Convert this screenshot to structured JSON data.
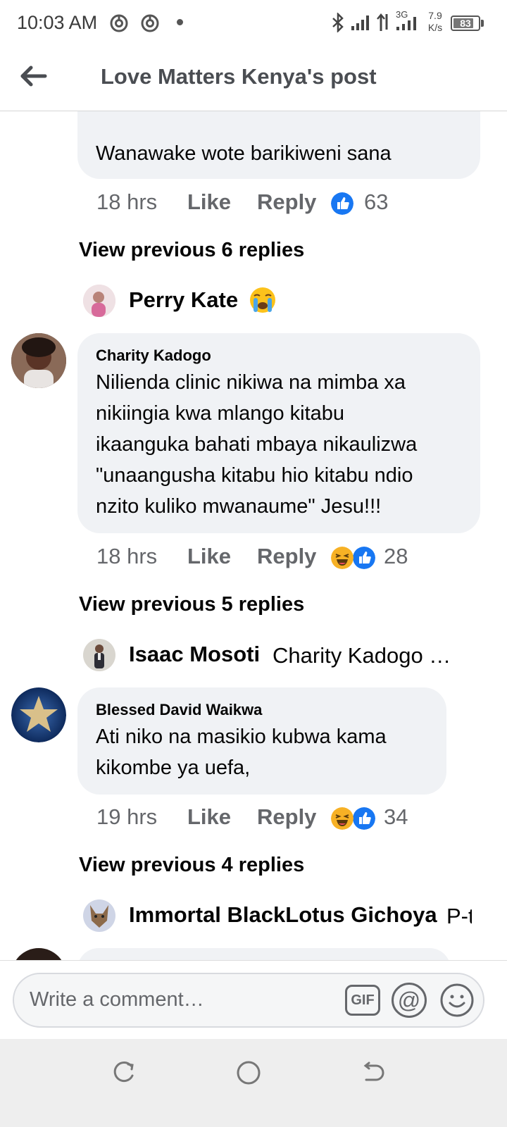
{
  "status_bar": {
    "time": "10:03 AM",
    "speed_value": "7.9",
    "speed_unit": "K/s",
    "network": "3G",
    "battery": "83",
    "battery_fraction": 0.83,
    "icons": [
      "chrome-icon",
      "chrome-icon",
      "notification-dot",
      "bluetooth-icon",
      "signal-icon",
      "data-arrows-icon",
      "signal-3g-icon",
      "battery-icon"
    ]
  },
  "header": {
    "title": "Love Matters Kenya's post",
    "back_icon": "arrow-left-icon"
  },
  "comments": [
    {
      "text": "Wanawake wote barikiweni sana",
      "time": "18 hrs",
      "like": "Like",
      "reply": "Reply",
      "reactions": [
        "like"
      ],
      "reaction_count": "63",
      "view_previous": "View previous 6 replies",
      "latest_reply": {
        "name": "Perry Kate",
        "emoji": "crying-face-emoji"
      }
    },
    {
      "author": "Charity Kadogo",
      "lines": [
        "Nilienda clinic nikiwa na mimba xa",
        "nikiingia kwa mlango kitabu",
        "ikaanguka bahati mbaya nikaulizwa",
        "\"unaangusha kitabu hio kitabu ndio",
        "nzito kuliko mwanaume\" Jesu!!!"
      ],
      "time": "18 hrs",
      "like": "Like",
      "reply": "Reply",
      "reactions": [
        "haha",
        "like"
      ],
      "reaction_count": "28",
      "view_previous": "View previous 5 replies",
      "latest_reply": {
        "name": "Isaac Mosoti",
        "text": "Charity Kadogo …"
      }
    },
    {
      "author": "Blessed David Waikwa",
      "lines": [
        "Ati niko na masikio kubwa kama",
        "kikombe ya uefa,"
      ],
      "time": "19 hrs",
      "like": "Like",
      "reply": "Reply",
      "reactions": [
        "haha",
        "like"
      ],
      "reaction_count": "34",
      "view_previous": "View previous 4 replies",
      "latest_reply": {
        "name": "Immortal BlackLotus Gichoya",
        "text": "P-t"
      }
    }
  ],
  "composer": {
    "placeholder": "Write a comment…",
    "gif_label": "GIF",
    "mention_label": "@",
    "emoji_icon": "smiley-icon"
  },
  "nav_bar": {
    "icons": [
      "recent-apps-icon",
      "home-icon",
      "back-icon"
    ]
  }
}
